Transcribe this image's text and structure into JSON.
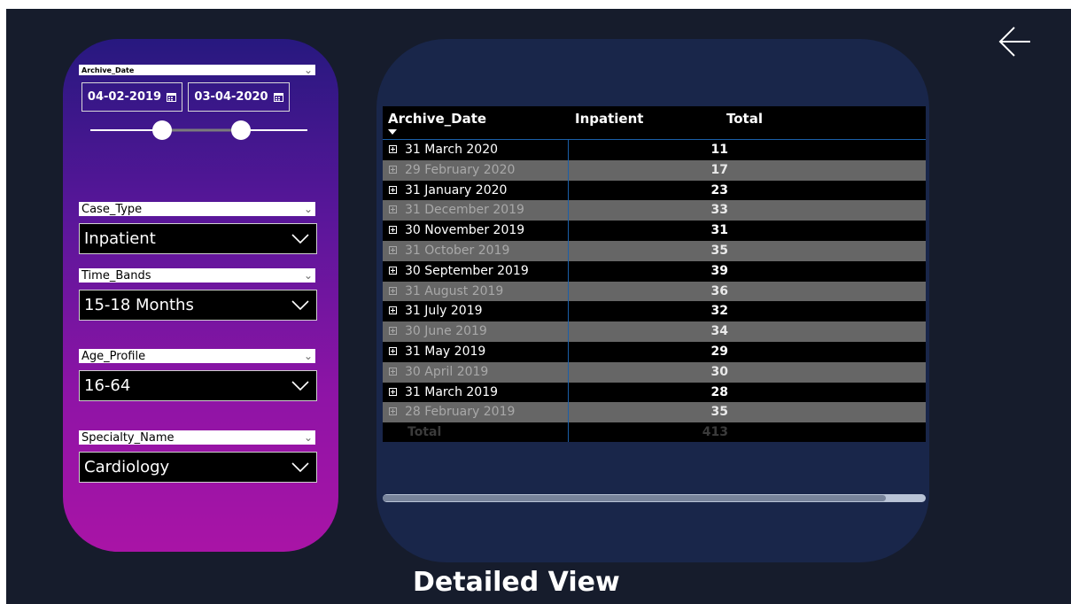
{
  "filters": {
    "archive_date": {
      "label": "Archive_Date",
      "start": "04-02-2019",
      "end": "03-04-2020"
    },
    "case_type": {
      "label": "Case_Type",
      "value": "Inpatient"
    },
    "time_bands": {
      "label": "Time_Bands",
      "value": "15-18 Months"
    },
    "age_profile": {
      "label": "Age_Profile",
      "value": "16-64"
    },
    "specialty_name": {
      "label": "Specialty_Name",
      "value": "Cardiology"
    }
  },
  "table": {
    "columns": [
      "Archive_Date",
      "Inpatient",
      "Total"
    ],
    "rows": [
      {
        "date": "31 March 2020",
        "inpatient": "11"
      },
      {
        "date": "29 February 2020",
        "inpatient": "17"
      },
      {
        "date": "31 January 2020",
        "inpatient": "23"
      },
      {
        "date": "31 December 2019",
        "inpatient": "33"
      },
      {
        "date": "30 November 2019",
        "inpatient": "31"
      },
      {
        "date": "31 October 2019",
        "inpatient": "35"
      },
      {
        "date": "30 September 2019",
        "inpatient": "39"
      },
      {
        "date": "31 August 2019",
        "inpatient": "36"
      },
      {
        "date": "31 July 2019",
        "inpatient": "32"
      },
      {
        "date": "30 June 2019",
        "inpatient": "34"
      },
      {
        "date": "31 May 2019",
        "inpatient": "29"
      },
      {
        "date": "30 April 2019",
        "inpatient": "30"
      },
      {
        "date": "31 March 2019",
        "inpatient": "28"
      },
      {
        "date": "28 February 2019",
        "inpatient": "35"
      }
    ],
    "total_label": "Total",
    "total_value": "413"
  },
  "page_title": "Detailed View",
  "icons": [
    "back-arrow-icon",
    "calendar-icon",
    "chevron-down-icon",
    "expand-icon",
    "sort-descending-icon"
  ]
}
